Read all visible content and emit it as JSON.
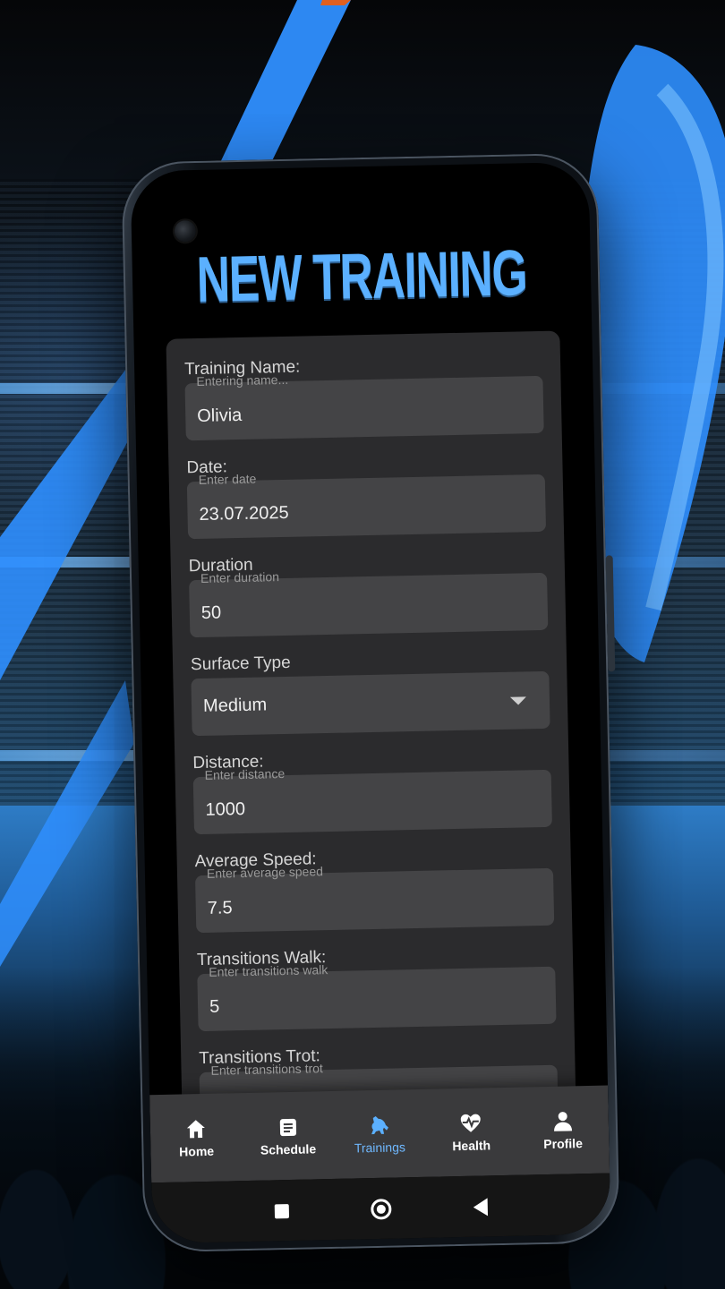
{
  "screen_title": "NEW TRAINING",
  "form": {
    "fields": [
      {
        "label": "Training Name:",
        "placeholder": "Entering name...",
        "value": "Olivia"
      },
      {
        "label": "Date:",
        "placeholder": "Enter date",
        "value": "23.07.2025"
      },
      {
        "label": "Duration",
        "placeholder": "Enter duration",
        "value": "50"
      },
      {
        "label": "Surface Type",
        "placeholder": "",
        "value": "Medium",
        "type": "select"
      },
      {
        "label": "Distance:",
        "placeholder": "Enter distance",
        "value": "1000"
      },
      {
        "label": "Average Speed:",
        "placeholder": "Enter average speed",
        "value": "7.5"
      },
      {
        "label": "Transitions Walk:",
        "placeholder": "Enter transitions walk",
        "value": "5"
      },
      {
        "label": "Transitions Trot:",
        "placeholder": "Enter transitions trot",
        "value": ""
      }
    ]
  },
  "nav": {
    "items": [
      {
        "label": "Home",
        "icon": "home-icon",
        "active": false
      },
      {
        "label": "Schedule",
        "icon": "schedule-icon",
        "active": false
      },
      {
        "label": "Trainings",
        "icon": "horse-icon",
        "active": true
      },
      {
        "label": "Health",
        "icon": "heart-pulse-icon",
        "active": false
      },
      {
        "label": "Profile",
        "icon": "person-icon",
        "active": false
      }
    ]
  },
  "system_nav": [
    "recents-button",
    "home-button",
    "back-button"
  ],
  "colors": {
    "accent": "#5bb0ff",
    "card_bg": "#2b2b2d",
    "input_bg": "#444446",
    "nav_bg": "#3a3a3c",
    "screen_bg": "#000000"
  }
}
